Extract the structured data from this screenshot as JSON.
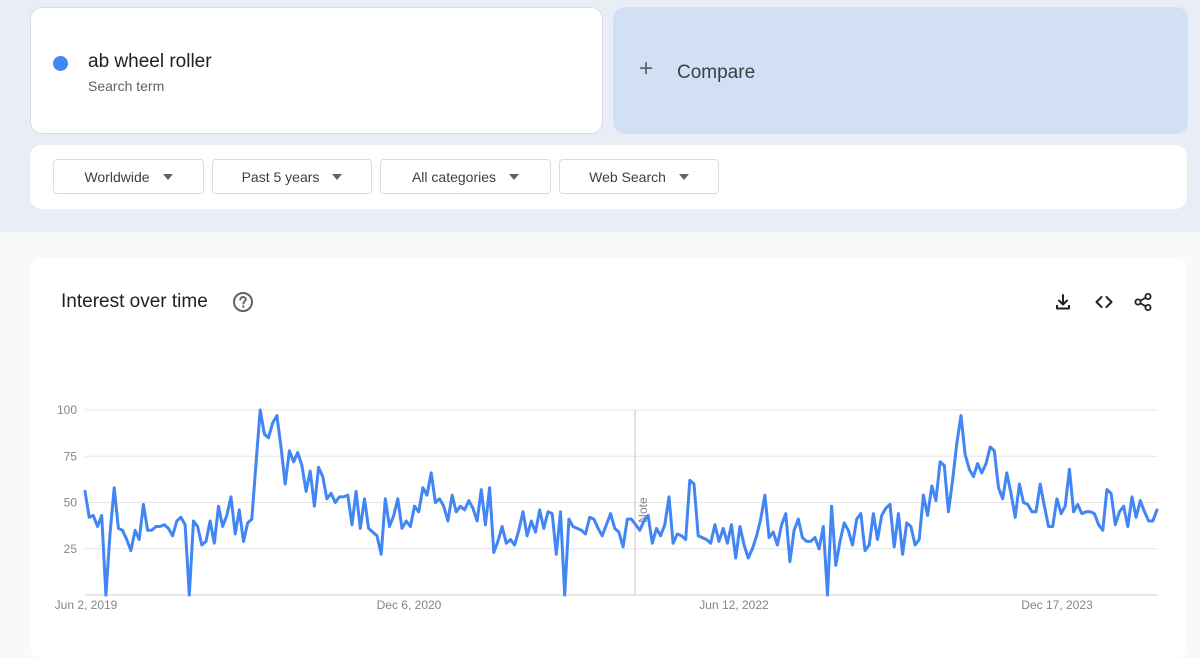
{
  "search_term": {
    "name": "ab wheel roller",
    "subtitle": "Search term",
    "color": "#4285f4"
  },
  "compare": {
    "plus": "+",
    "label": "Compare"
  },
  "filters": {
    "region": "Worldwide",
    "time_range": "Past 5 years",
    "category": "All categories",
    "search_type": "Web Search"
  },
  "chart": {
    "title": "Interest over time",
    "icons": [
      "help-icon",
      "download-icon",
      "embed-icon",
      "share-icon"
    ],
    "note_label": "Note"
  },
  "chart_data": {
    "type": "line",
    "title": "Interest over time",
    "xlabel": "",
    "ylabel": "",
    "ylim": [
      0,
      100
    ],
    "y_ticks": [
      100,
      75,
      50,
      25
    ],
    "x_tick_labels": [
      "Jun 2, 2019",
      "Dec 6, 2020",
      "Jun 12, 2022",
      "Dec 17, 2023"
    ],
    "x_range": [
      "2019-06-02",
      "2024-05-26"
    ],
    "note_date": "2022-01-01",
    "grid": true,
    "series": [
      {
        "name": "ab wheel roller",
        "color": "#4285f4",
        "values": [
          56,
          42,
          43,
          37,
          43,
          0,
          33,
          58,
          36,
          35,
          30,
          24,
          35,
          30,
          49,
          35,
          35,
          37,
          37,
          38,
          36,
          32,
          40,
          42,
          38,
          0,
          40,
          37,
          27,
          29,
          40,
          28,
          48,
          37,
          43,
          53,
          33,
          46,
          29,
          39,
          41,
          71,
          100,
          87,
          85,
          93,
          97,
          80,
          60,
          78,
          72,
          77,
          70,
          56,
          67,
          48,
          69,
          64,
          52,
          55,
          50,
          53,
          53,
          54,
          38,
          56,
          36,
          52,
          36,
          34,
          32,
          22,
          52,
          37,
          43,
          52,
          36,
          40,
          37,
          48,
          45,
          58,
          54,
          66,
          50,
          52,
          48,
          40,
          54,
          45,
          48,
          46,
          51,
          47,
          40,
          57,
          38,
          58,
          23,
          29,
          37,
          28,
          30,
          27,
          35,
          45,
          32,
          40,
          34,
          46,
          36,
          45,
          44,
          22,
          45,
          0,
          41,
          37,
          36,
          35,
          33,
          42,
          41,
          36,
          32,
          38,
          44,
          36,
          34,
          26,
          41,
          41,
          38,
          35,
          40,
          43,
          28,
          36,
          32,
          38,
          53,
          28,
          33,
          32,
          30,
          62,
          60,
          32,
          31,
          30,
          28,
          38,
          29,
          36,
          28,
          38,
          20,
          37,
          27,
          20,
          25,
          32,
          41,
          54,
          31,
          34,
          27,
          38,
          44,
          18,
          35,
          41,
          31,
          29,
          29,
          31,
          25,
          37,
          0,
          48,
          16,
          29,
          39,
          35,
          27,
          41,
          44,
          24,
          27,
          44,
          30,
          43,
          47,
          49,
          26,
          44,
          22,
          39,
          37,
          27,
          30,
          54,
          43,
          59,
          51,
          72,
          70,
          45,
          62,
          82,
          97,
          76,
          68,
          64,
          71,
          66,
          71,
          80,
          78,
          58,
          52,
          66,
          55,
          42,
          60,
          50,
          49,
          45,
          45,
          60,
          48,
          37,
          37,
          52,
          44,
          48,
          68,
          45,
          49,
          44,
          45,
          45,
          44,
          38,
          35,
          57,
          55,
          38,
          45,
          48,
          37,
          53,
          42,
          51,
          45,
          40,
          40,
          46
        ]
      }
    ]
  }
}
